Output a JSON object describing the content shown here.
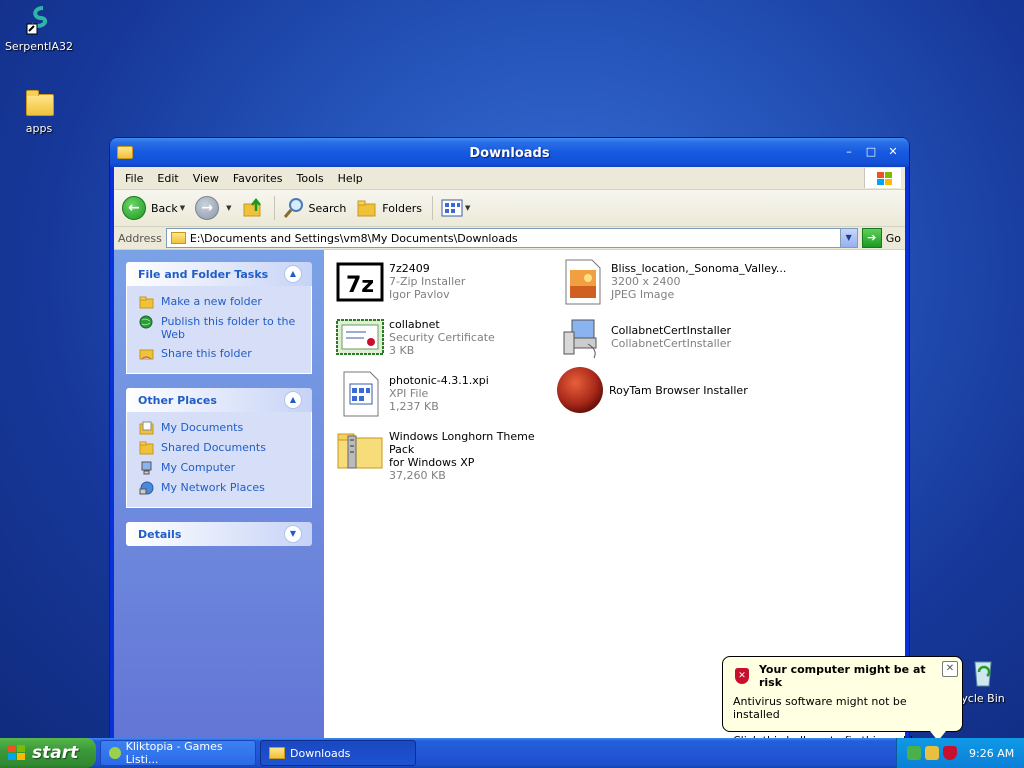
{
  "desktop": {
    "icons": [
      {
        "label": "SerpentIA32"
      },
      {
        "label": "apps"
      },
      {
        "label": "ycle Bin"
      }
    ]
  },
  "window": {
    "title": "Downloads",
    "menu": [
      "File",
      "Edit",
      "View",
      "Favorites",
      "Tools",
      "Help"
    ],
    "toolbar": {
      "back": "Back",
      "search": "Search",
      "folders": "Folders"
    },
    "address": {
      "label": "Address",
      "value": "E:\\Documents and Settings\\vm8\\My Documents\\Downloads",
      "go": "Go"
    }
  },
  "tasks": {
    "file_folder": {
      "title": "File and Folder Tasks",
      "items": [
        "Make a new folder",
        "Publish this folder to the Web",
        "Share this folder"
      ]
    },
    "other_places": {
      "title": "Other Places",
      "items": [
        "My Documents",
        "Shared Documents",
        "My Computer",
        "My Network Places"
      ]
    },
    "details": {
      "title": "Details"
    }
  },
  "files": [
    {
      "name": "7z2409",
      "line2": "7-Zip Installer",
      "line3": "Igor Pavlov",
      "icon": "7zip-icon"
    },
    {
      "name": "collabnet",
      "line2": "Security Certificate",
      "line3": "3 KB",
      "icon": "certificate-icon"
    },
    {
      "name": "photonic-4.3.1.xpi",
      "line2": "XPI File",
      "line3": "1,237 KB",
      "icon": "xpi-file-icon"
    },
    {
      "name": "Windows Longhorn Theme Pack",
      "line2": "for Windows XP",
      "line3": "37,260 KB",
      "icon": "zip-folder-icon"
    },
    {
      "name": "Bliss_location,_Sonoma_Valley...",
      "line2": "3200 x 2400",
      "line3": "JPEG Image",
      "icon": "jpeg-image-icon"
    },
    {
      "name": "CollabnetCertInstaller",
      "line2": "CollabnetCertInstaller",
      "line3": "",
      "icon": "installer-icon"
    },
    {
      "name": "RoyTam Browser Installer",
      "line2": "",
      "line3": "",
      "icon": "browser-installer-icon"
    }
  ],
  "taskbar": {
    "start": "start",
    "tasks": [
      "Kliktopia - Games Listi...",
      "Downloads"
    ],
    "clock": "9:26 AM"
  },
  "balloon": {
    "title": "Your computer might be at risk",
    "line1": "Antivirus software might not be installed",
    "line2": "Click this balloon to fix this problem."
  },
  "colors": {
    "xp_blue": "#0831d9",
    "task_pane": "#7ba2e7",
    "link": "#215dc6",
    "balloon_bg": "#ffffe1"
  }
}
